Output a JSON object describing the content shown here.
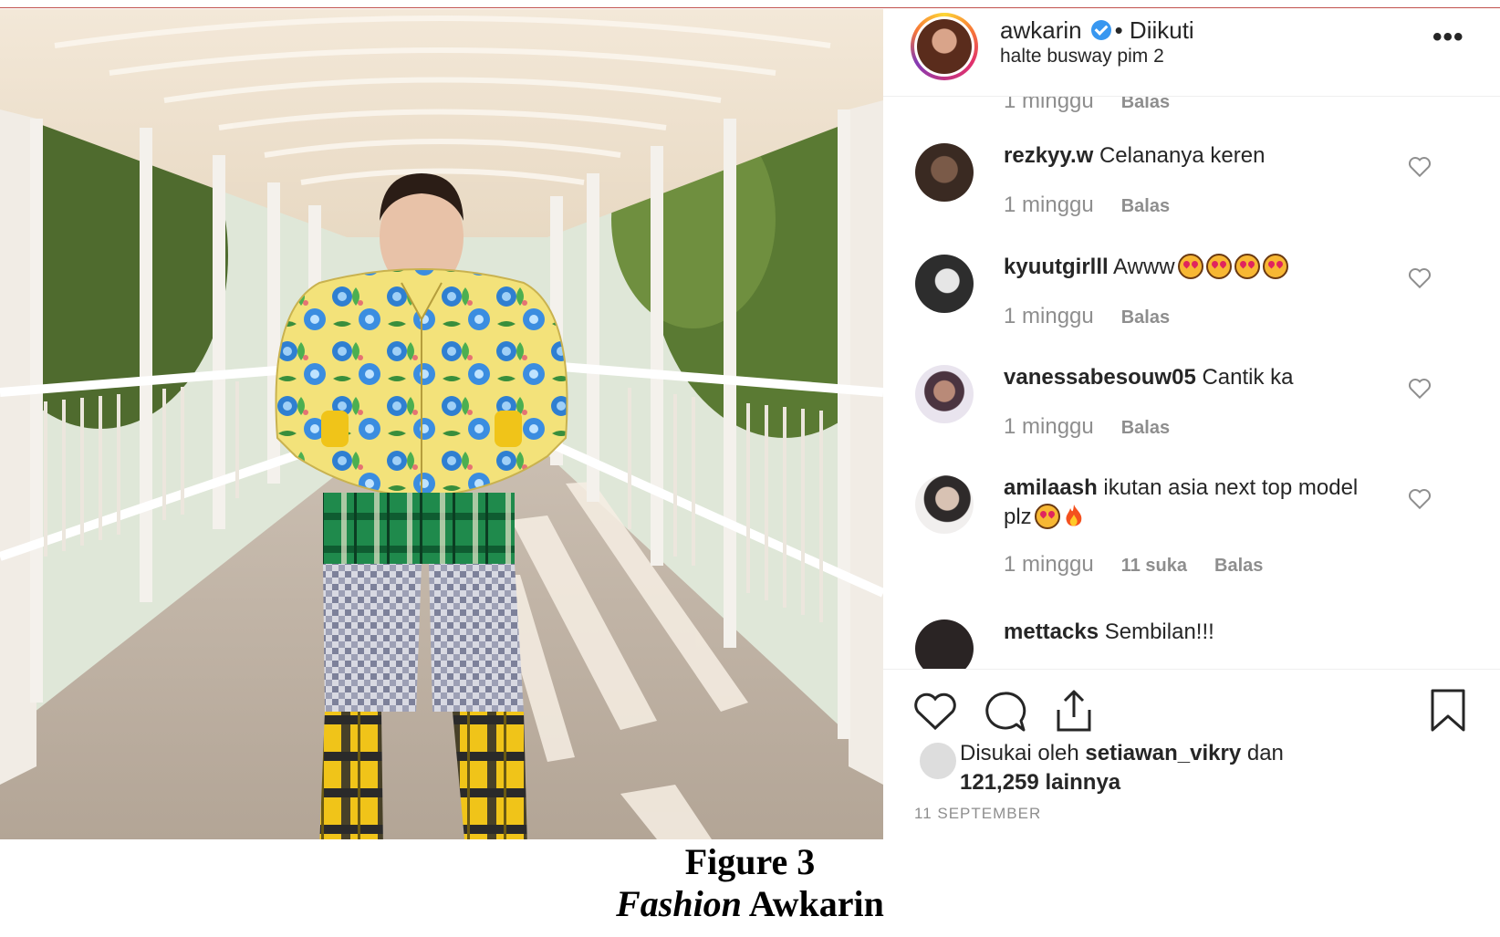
{
  "post": {
    "username": "awkarin",
    "follow_status": "• Diikuti",
    "location": "halte busway pim 2",
    "more_icon": "•••"
  },
  "comments": [
    {
      "user": "",
      "text": "",
      "time": "1 minggu",
      "likes": "",
      "reply": "Balas"
    },
    {
      "user": "rezkyy.w",
      "text": "Celananya keren",
      "time": "1 minggu",
      "likes": "",
      "reply": "Balas"
    },
    {
      "user": "kyuutgirlll",
      "text": "Awww",
      "emoji_count": 4,
      "time": "1 minggu",
      "likes": "",
      "reply": "Balas"
    },
    {
      "user": "vanessabesouw05",
      "text": "Cantik ka",
      "time": "1 minggu",
      "likes": "",
      "reply": "Balas"
    },
    {
      "user": "amilaash",
      "text": "ikutan asia next top model plz",
      "time": "1 minggu",
      "likes": "11 suka",
      "reply": "Balas"
    },
    {
      "user": "mettacks",
      "text": "Sembilan!!!",
      "time": "",
      "likes": "",
      "reply": ""
    }
  ],
  "likes": {
    "prefix": "Disukai oleh",
    "user": "setiawan_vikry",
    "middle": "dan",
    "count": "121,259",
    "suffix": "lainnya"
  },
  "date": "11 SEPTEMBER",
  "figure": {
    "number": "Figure 3",
    "title_italic": "Fashion",
    "title_rest": "Awkarin"
  },
  "colors": {
    "verified": "#3897f0",
    "text": "#262626",
    "muted": "#8e8e8e",
    "caption_rule": "#c0504d"
  },
  "icons": [
    "heart-icon",
    "comment-icon",
    "share-icon",
    "bookmark-icon",
    "verified-badge-icon",
    "more-options-icon"
  ]
}
